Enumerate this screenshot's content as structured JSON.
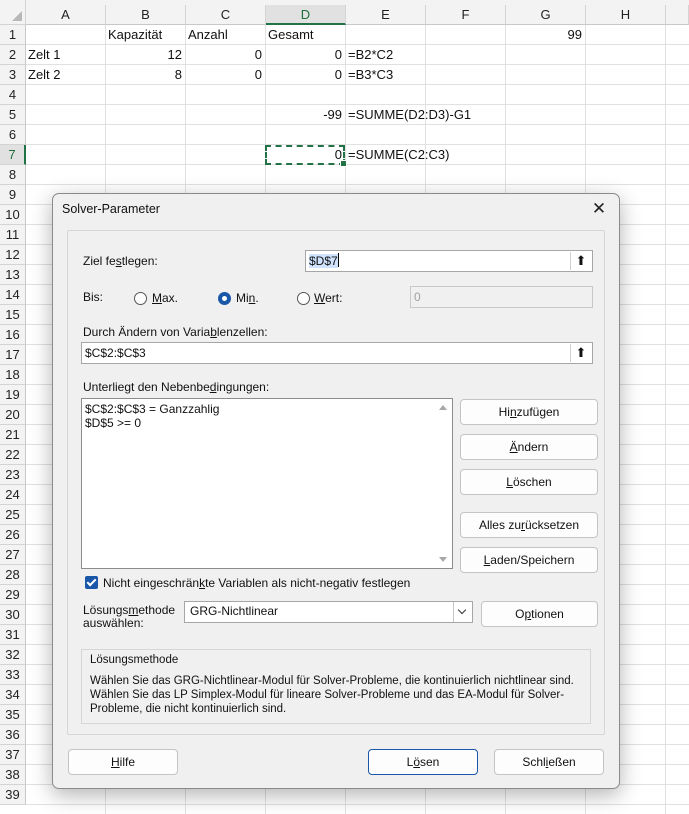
{
  "sheet": {
    "columns": [
      "A",
      "B",
      "C",
      "D",
      "E",
      "F",
      "G",
      "H"
    ],
    "rows": [
      "1",
      "2",
      "3",
      "4",
      "5",
      "6",
      "7",
      "8",
      "9",
      "10",
      "11",
      "12",
      "13",
      "14",
      "15",
      "16",
      "17",
      "18",
      "19",
      "20",
      "21",
      "22",
      "23",
      "24",
      "25",
      "26",
      "27",
      "28",
      "29",
      "30",
      "31",
      "32",
      "33",
      "34",
      "35",
      "36",
      "37",
      "38",
      "39"
    ],
    "cells": {
      "B1": "Kapazität",
      "C1": "Anzahl",
      "D1": "Gesamt",
      "G1": "99",
      "A2": "Zelt 1",
      "B2": "12",
      "C2": "0",
      "D2": "0",
      "E2": "=B2*C2",
      "A3": "Zelt 2",
      "B3": "8",
      "C3": "0",
      "D3": "0",
      "E3": "=B3*C3",
      "D5": "-99",
      "E5": "=SUMME(D2:D3)-G1",
      "D7": "0",
      "E7": "=SUMME(C2:C3)"
    },
    "selected_column": "D",
    "selected_row": "7"
  },
  "dialog": {
    "title": "Solver-Parameter",
    "objective": {
      "label": "Ziel festlegen:",
      "value": "$D$7"
    },
    "to": {
      "label": "Bis:",
      "max_label": "Max.",
      "min_label": "Min.",
      "value_label": "Wert:",
      "selected": "min",
      "value_input": "0"
    },
    "variables": {
      "label": "Durch Ändern von Variablenzellen:",
      "value": "$C$2:$C$3"
    },
    "constraints": {
      "label": "Unterliegt den Nebenbedingungen:",
      "items": [
        "$C$2:$C$3 = Ganzzahlig",
        "$D$5 >= 0"
      ]
    },
    "side_buttons": {
      "add": "Hinzufügen",
      "change": "Ändern",
      "delete": "Löschen",
      "reset_all": "Alles zurücksetzen",
      "load_save": "Laden/Speichern"
    },
    "nonneg": {
      "label": "Nicht eingeschränkte Variablen als nicht-negativ festlegen",
      "checked": true
    },
    "method": {
      "label_line1": "Lösungsmethode",
      "label_line2": "auswählen:",
      "selected": "GRG-Nichtlinear",
      "options_button": "Optionen"
    },
    "method_info": {
      "title": "Lösungsmethode",
      "text": "Wählen Sie das GRG-Nichtlinear-Modul für Solver-Probleme, die kontinuierlich nichtlinear sind. Wählen Sie das LP Simplex-Modul für lineare Solver-Probleme und das EA-Modul für Solver-Probleme, die nicht kontinuierlich sind."
    },
    "footer": {
      "help": "Hilfe",
      "solve": "Lösen",
      "close": "Schließen"
    },
    "icons": {
      "close": "close-icon",
      "collapse": "collapse-dialog-icon"
    },
    "accent": "#1a57a8",
    "grid_accent": "#217346"
  }
}
